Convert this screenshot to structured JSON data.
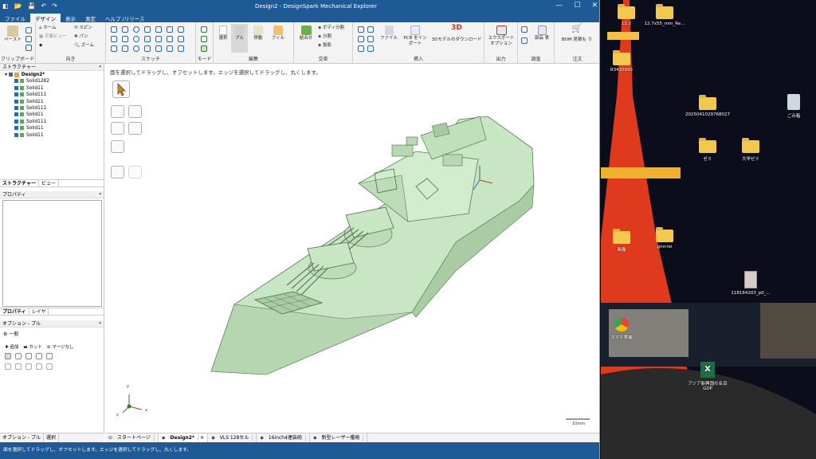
{
  "window": {
    "title": "Design2 - DesignSpark Mechanical Explorer",
    "controls": [
      "—",
      "☐",
      "✕"
    ]
  },
  "ribbon_tabs": [
    "ファイル",
    "デザイン",
    "表示",
    "測定",
    "ヘルプ /リリース"
  ],
  "ribbon": {
    "clipboard": {
      "paste": "ペースト",
      "label": "クリップボード"
    },
    "orient": {
      "home": "ホーム",
      "plane_view": "平面ビュー",
      "spin": "スピン",
      "pan": "パン",
      "zoom": "ズーム",
      "label": "向き"
    },
    "sketch": {
      "label": "スケッチ"
    },
    "mode": {
      "label": "モード"
    },
    "edit": {
      "select": "選択",
      "pull": "プル",
      "move": "移動",
      "fill": "フィル",
      "label": "編集"
    },
    "intersect": {
      "combine": "結合せ",
      "split_body": "ボディ分割",
      "split": "分割",
      "project": "投影",
      "label": "交差"
    },
    "insert": {
      "file": "ファイル",
      "pcb": "PCB をイン ポート",
      "download": "3Dモデルのダウンロード",
      "label": "挿入"
    },
    "output": {
      "export": "エクスポート オプション",
      "label": "出力"
    },
    "investigate": {
      "parts": "部品 表",
      "label": "調査"
    },
    "order": {
      "bom": "BOM 見積も り",
      "label": "注文"
    }
  },
  "structure": {
    "header": "ストラクチャー",
    "root": "Design2*",
    "items": [
      "Solid1282",
      "Solid11",
      "Solid111",
      "Solid11",
      "Solid111",
      "Solid11",
      "Solid111",
      "Solid11",
      "Solid11"
    ],
    "tabs": [
      "ストラクチャー",
      "ビュー"
    ]
  },
  "properties": {
    "header": "プロパティ",
    "tabs": [
      "プロパティ",
      "レイヤ"
    ]
  },
  "options": {
    "header": "オプション - プル",
    "general": "一般",
    "add": "追加",
    "cut": "カット",
    "no_merge": "マージなし"
  },
  "viewport": {
    "hint": "面を選択してドラッグし、オフセットします。エッジを選択してドラッグし、丸くします。",
    "scale": "10mm",
    "axis_x": "x",
    "axis_y": "y",
    "axis_z": "z"
  },
  "doc_tabs": [
    "スタートページ",
    "Design2*",
    "VLS 128セル",
    "16inch4連装砲",
    "新型レーザー艦砲"
  ],
  "left_bottom_tabs": [
    "オプション - プル",
    "選択"
  ],
  "status": "面を選択してドラッグし、オフセットします。エッジを選択してドラッグし、丸くします。",
  "desktop": {
    "icons": [
      {
        "label": "12.2",
        "kind": "folder"
      },
      {
        "label": "12.7x55_mm_Re...",
        "kind": "folder"
      },
      {
        "label": "R3435695",
        "kind": "folder"
      },
      {
        "label": "ごみ箱",
        "kind": "bin"
      },
      {
        "label": "2025041029768027",
        "kind": "folder"
      },
      {
        "label": "ゼミ",
        "kind": "folder"
      },
      {
        "label": "大学ゼミ",
        "kind": "folder"
      },
      {
        "label": "画像",
        "kind": "folder"
      },
      {
        "label": "ginnrei",
        "kind": "folder"
      },
      {
        "label": "118184203_p0_...",
        "kind": "image"
      },
      {
        "label": "スマホ拿捕",
        "kind": "chrome"
      },
      {
        "label": "アジア新興国の名目GDP",
        "kind": "excel"
      }
    ]
  },
  "colors": {
    "accent": "#1e5a96",
    "model": "#c8e6c4",
    "tower": "#e03a1e"
  }
}
